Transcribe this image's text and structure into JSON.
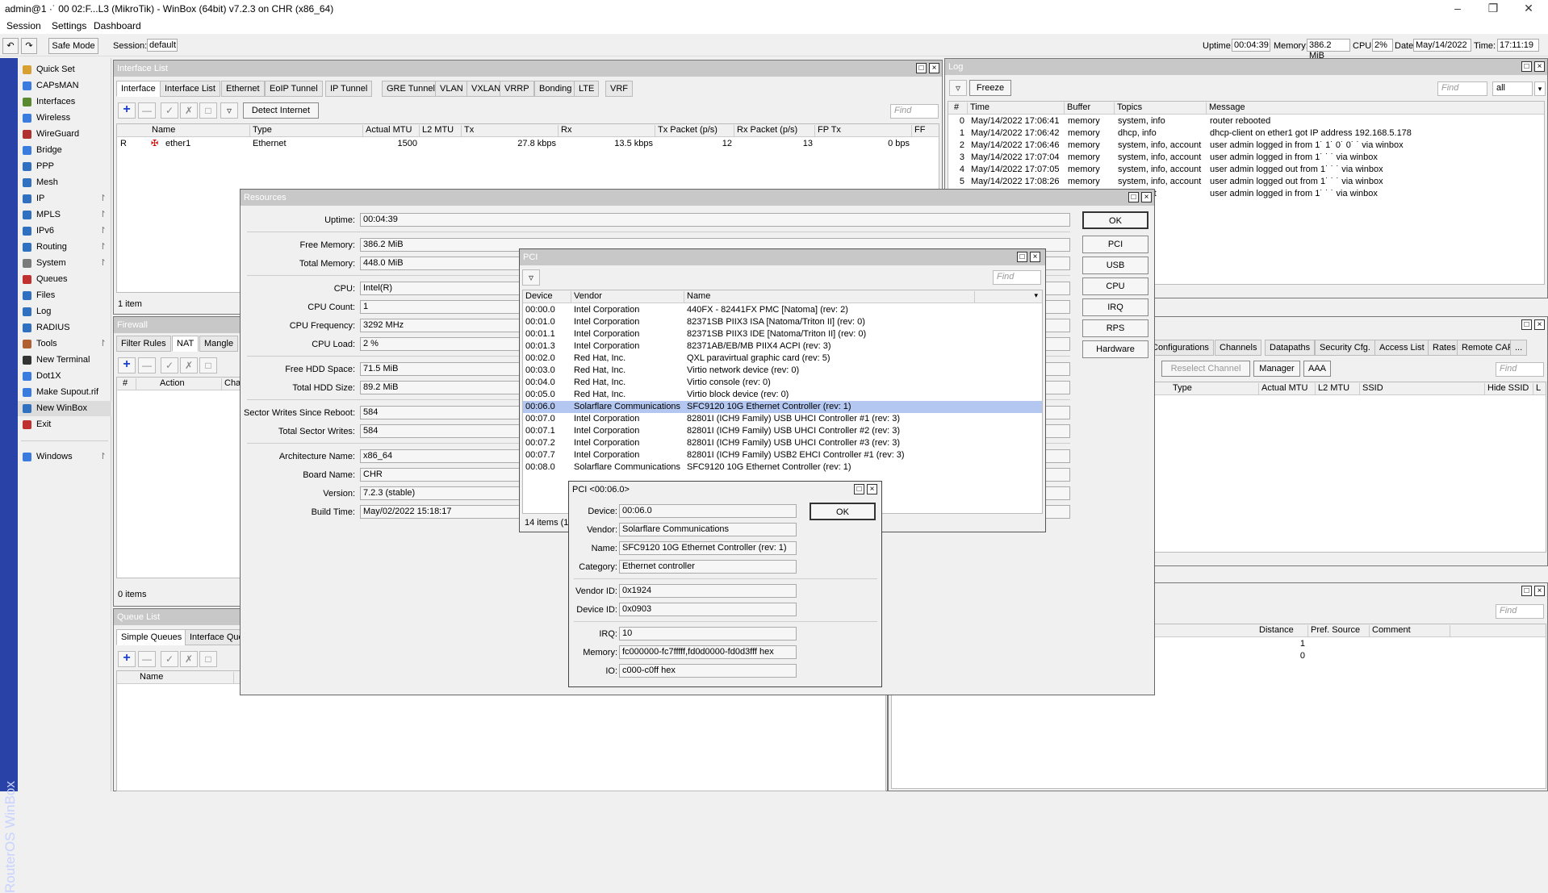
{
  "app": {
    "title": "admin@192.168.5.173 (MikroTik) - WinBox (64bit) v7.2.3 on CHR (x86_64)",
    "title_visible": "admin@1  ·˙ 00 02:F...L3 (MikroTik) - WinBox (64bit) v7.2.3 on CHR (x86_64)",
    "brand": "RouterOS WinBox"
  },
  "menu": {
    "session": "Session",
    "settings": "Settings",
    "dashboard": "Dashboard"
  },
  "toolbar": {
    "safe_mode": "Safe Mode",
    "session_label": "Session:",
    "session_value": "default",
    "uptime_label": "Uptime:",
    "uptime_value": "00:04:39",
    "memory_label": "Memory:",
    "memory_value": "386.2 MiB",
    "cpu_label": "CPU:",
    "cpu_value": "2%",
    "date_label": "Date:",
    "date_value": "May/14/2022",
    "time_label": "Time:",
    "time_value": "17:11:19"
  },
  "sidebar": {
    "items": [
      {
        "label": "Quick Set",
        "arrow": ""
      },
      {
        "label": "CAPsMAN",
        "arrow": ""
      },
      {
        "label": "Interfaces",
        "arrow": ""
      },
      {
        "label": "Wireless",
        "arrow": ""
      },
      {
        "label": "WireGuard",
        "arrow": ""
      },
      {
        "label": "Bridge",
        "arrow": ""
      },
      {
        "label": "PPP",
        "arrow": ""
      },
      {
        "label": "Mesh",
        "arrow": ""
      },
      {
        "label": "IP",
        "arrow": "↾"
      },
      {
        "label": "MPLS",
        "arrow": "↾"
      },
      {
        "label": "IPv6",
        "arrow": "↾"
      },
      {
        "label": "Routing",
        "arrow": "↾"
      },
      {
        "label": "System",
        "arrow": "↾"
      },
      {
        "label": "Queues",
        "arrow": ""
      },
      {
        "label": "Files",
        "arrow": ""
      },
      {
        "label": "Log",
        "arrow": ""
      },
      {
        "label": "RADIUS",
        "arrow": ""
      },
      {
        "label": "Tools",
        "arrow": "↾"
      },
      {
        "label": "New Terminal",
        "arrow": ""
      },
      {
        "label": "Dot1X",
        "arrow": ""
      },
      {
        "label": "Make Supout.rif",
        "arrow": ""
      },
      {
        "label": "New WinBox",
        "arrow": ""
      },
      {
        "label": "Exit",
        "arrow": ""
      },
      {
        "label": "Windows",
        "arrow": "↾"
      }
    ]
  },
  "iface": {
    "title": "Interface List",
    "tabs": [
      "Interface",
      "Interface List",
      "Ethernet",
      "EoIP Tunnel",
      "IP Tunnel",
      "GRE Tunnel",
      "VLAN",
      "VXLAN",
      "VRRP",
      "Bonding",
      "LTE",
      "VRF"
    ],
    "detect": "Detect Internet",
    "find": "Find",
    "cols": [
      "Name",
      "Type",
      "Actual MTU",
      "L2 MTU",
      "Tx",
      "Rx",
      "Tx Packet (p/s)",
      "Rx Packet (p/s)",
      "FP Tx",
      "FF"
    ],
    "row": {
      "flag": "R",
      "name": "ether1",
      "type": "Ethernet",
      "mtu": "1500",
      "tx": "27.8 kbps",
      "rx": "13.5 kbps",
      "txp": "12",
      "rxp": "13",
      "fptx": "0 bps"
    },
    "count": "1 item"
  },
  "firewall": {
    "title": "Firewall",
    "tabs": [
      "Filter Rules",
      "NAT",
      "Mangle"
    ],
    "cols": [
      "#",
      "Action",
      "Cha"
    ],
    "count": "0 items"
  },
  "queue": {
    "title": "Queue List",
    "tabs": [
      "Simple Queues",
      "Interface Que"
    ],
    "cols": [
      "Name"
    ]
  },
  "log": {
    "title": "Log",
    "freeze": "Freeze",
    "find": "Find",
    "filter": "all",
    "cols": [
      "#",
      "Time",
      "Buffer",
      "Topics",
      "Message"
    ],
    "rows": [
      {
        "n": "0",
        "time": "May/14/2022 17:06:41",
        "buf": "memory",
        "topics": "system, info",
        "msg": "router rebooted"
      },
      {
        "n": "1",
        "time": "May/14/2022 17:06:42",
        "buf": "memory",
        "topics": "dhcp, info",
        "msg": "dhcp-client on ether1 got IP address 192.168.5.178"
      },
      {
        "n": "2",
        "time": "May/14/2022 17:06:46",
        "buf": "memory",
        "topics": "system, info, account",
        "msg": "user admin logged in from 1˙ 1˙ 0˙ 0˙ ˙ via winbox"
      },
      {
        "n": "3",
        "time": "May/14/2022 17:07:04",
        "buf": "memory",
        "topics": "system, info, account",
        "msg": "user admin logged in from 1˙ ˙ ˙ via winbox"
      },
      {
        "n": "4",
        "time": "May/14/2022 17:07:05",
        "buf": "memory",
        "topics": "system, info, account",
        "msg": "user admin logged out from 1˙ ˙ ˙ via winbox"
      },
      {
        "n": "5",
        "time": "May/14/2022 17:08:26",
        "buf": "memory",
        "topics": "system, info, account",
        "msg": "user admin logged out from 1˙ ˙ ˙ via winbox"
      },
      {
        "n": "",
        "time": "",
        "buf": "",
        "topics": "...account",
        "msg": "user admin logged in from 1˙ ˙ ˙ via winbox"
      }
    ]
  },
  "capsman": {
    "tabs": [
      "Configurations",
      "Channels",
      "Datapaths",
      "Security Cfg.",
      "Access List",
      "Rates",
      "Remote CAP",
      "..."
    ],
    "reselect": "Reselect Channel",
    "manager": "Manager",
    "aaa": "AAA",
    "find": "Find",
    "cols": [
      "Type",
      "Actual MTU",
      "L2 MTU",
      "SSID",
      "Hide SSID",
      "L"
    ]
  },
  "routes": {
    "find": "Find",
    "cols": [
      "Distance",
      "Pref. Source",
      "Comment"
    ],
    "values": [
      "1",
      "0"
    ]
  },
  "resources": {
    "title": "Resources",
    "fields": [
      {
        "label": "Uptime:",
        "value": "00:04:39"
      },
      {
        "label": "Free Memory:",
        "value": "386.2 MiB"
      },
      {
        "label": "Total Memory:",
        "value": "448.0 MiB"
      },
      {
        "label": "CPU:",
        "value": "Intel(R)"
      },
      {
        "label": "CPU Count:",
        "value": "1"
      },
      {
        "label": "CPU Frequency:",
        "value": "3292 MHz"
      },
      {
        "label": "CPU Load:",
        "value": "2 %"
      },
      {
        "label": "Free HDD Space:",
        "value": "71.5 MiB"
      },
      {
        "label": "Total HDD Size:",
        "value": "89.2 MiB"
      },
      {
        "label": "Sector Writes Since Reboot:",
        "value": "584"
      },
      {
        "label": "Total Sector Writes:",
        "value": "584"
      },
      {
        "label": "Architecture Name:",
        "value": "x86_64"
      },
      {
        "label": "Board Name:",
        "value": "CHR"
      },
      {
        "label": "Version:",
        "value": "7.2.3 (stable)"
      },
      {
        "label": "Build Time:",
        "value": "May/02/2022 15:18:17"
      }
    ],
    "buttons": [
      "OK",
      "PCI",
      "USB",
      "CPU",
      "IRQ",
      "RPS",
      "Hardware"
    ]
  },
  "pci": {
    "title": "PCI",
    "find": "Find",
    "cols": [
      "Device",
      "Vendor",
      "Name"
    ],
    "rows": [
      {
        "d": "00:00.0",
        "v": "Intel Corporation",
        "n": "440FX - 82441FX PMC [Natoma] (rev: 2)"
      },
      {
        "d": "00:01.0",
        "v": "Intel Corporation",
        "n": "82371SB PIIX3 ISA [Natoma/Triton II] (rev: 0)"
      },
      {
        "d": "00:01.1",
        "v": "Intel Corporation",
        "n": "82371SB PIIX3 IDE [Natoma/Triton II] (rev: 0)"
      },
      {
        "d": "00:01.3",
        "v": "Intel Corporation",
        "n": "82371AB/EB/MB PIIX4 ACPI (rev: 3)"
      },
      {
        "d": "00:02.0",
        "v": "Red Hat, Inc.",
        "n": "QXL paravirtual graphic card (rev: 5)"
      },
      {
        "d": "00:03.0",
        "v": "Red Hat, Inc.",
        "n": "Virtio network device (rev: 0)"
      },
      {
        "d": "00:04.0",
        "v": "Red Hat, Inc.",
        "n": "Virtio console (rev: 0)"
      },
      {
        "d": "00:05.0",
        "v": "Red Hat, Inc.",
        "n": "Virtio block device (rev: 0)"
      },
      {
        "d": "00:06.0",
        "v": "Solarflare Communications",
        "n": "SFC9120 10G Ethernet Controller (rev: 1)"
      },
      {
        "d": "00:07.0",
        "v": "Intel Corporation",
        "n": "82801I (ICH9 Family) USB UHCI Controller #1 (rev: 3)"
      },
      {
        "d": "00:07.1",
        "v": "Intel Corporation",
        "n": "82801I (ICH9 Family) USB UHCI Controller #2 (rev: 3)"
      },
      {
        "d": "00:07.2",
        "v": "Intel Corporation",
        "n": "82801I (ICH9 Family) USB UHCI Controller #3 (rev: 3)"
      },
      {
        "d": "00:07.7",
        "v": "Intel Corporation",
        "n": "82801I (ICH9 Family) USB2 EHCI Controller #1 (rev: 3)"
      },
      {
        "d": "00:08.0",
        "v": "Solarflare Communications",
        "n": "SFC9120 10G Ethernet Controller (rev: 1)"
      }
    ],
    "selected_index": 8,
    "count": "14 items (1"
  },
  "pcidetail": {
    "title": "PCI <00:06.0>",
    "ok": "OK",
    "fields": [
      {
        "label": "Device:",
        "value": "00:06.0"
      },
      {
        "label": "Vendor:",
        "value": "Solarflare Communications"
      },
      {
        "label": "Name:",
        "value": "SFC9120 10G Ethernet Controller (rev: 1)"
      },
      {
        "label": "Category:",
        "value": "Ethernet controller"
      },
      {
        "label": "Vendor ID:",
        "value": "0x1924"
      },
      {
        "label": "Device ID:",
        "value": "0x0903"
      },
      {
        "label": "IRQ:",
        "value": "10"
      },
      {
        "label": "Memory:",
        "value": "fc000000-fc7fffff,fd0d0000-fd0d3fff hex"
      },
      {
        "label": "IO:",
        "value": "c000-c0ff hex"
      }
    ]
  },
  "colors": {
    "brand": "#2842a8",
    "selection": "#b3c7f0",
    "accent_blue": "#1a3fcf"
  }
}
